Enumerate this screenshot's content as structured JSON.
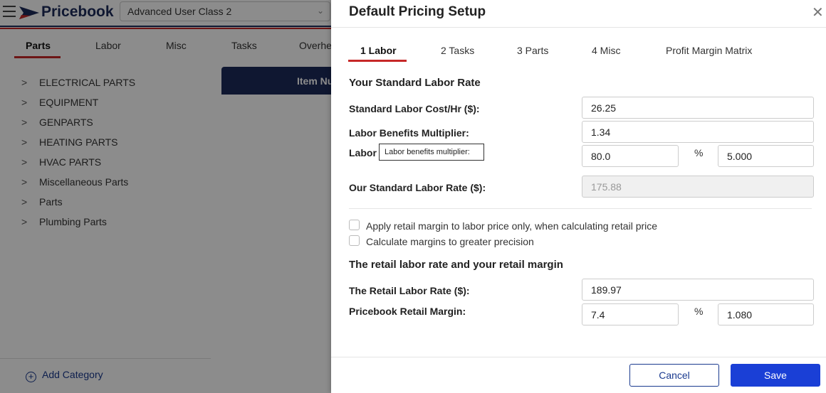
{
  "app": {
    "logo_text": "Pricebook",
    "class_select_value": "Advanced User Class 2",
    "tabs": [
      "Parts",
      "Labor",
      "Misc",
      "Tasks",
      "Overhe"
    ],
    "categories": [
      "ELECTRICAL PARTS",
      "EQUIPMENT",
      "GENPARTS",
      "HEATING PARTS",
      "HVAC PARTS",
      "Miscellaneous Parts",
      "Parts",
      "Plumbing Parts"
    ],
    "add_category_label": "Add Category",
    "item_header_label": "Item Nu",
    "colors": {
      "navy": "#1c2a5a",
      "red": "#c62828",
      "primary": "#1a3fd6"
    }
  },
  "dialog": {
    "title": "Default Pricing Setup",
    "close_icon": "close-icon",
    "tabs": [
      "1 Labor",
      "2 Tasks",
      "3 Parts",
      "4 Misc",
      "Profit Margin Matrix"
    ],
    "standard_section_title": "Your Standard Labor Rate",
    "labor_cost_label": "Standard Labor Cost/Hr ($):",
    "labor_cost_value": "26.25",
    "benefits_multiplier_label": "Labor Benefits Multiplier:",
    "benefits_multiplier_value": "1.34",
    "labor_row_label": "Labor",
    "labor_row_value_1": "80.0",
    "labor_row_value_2": "5.000",
    "pct_symbol": "%",
    "tooltip_text": "Labor benefits multiplier:",
    "our_rate_label": "Our Standard Labor Rate ($):",
    "our_rate_value": "175.88",
    "checkbox_1_label": "Apply retail margin to labor price only, when calculating retail price",
    "checkbox_2_label": "Calculate margins to greater precision",
    "retail_section_title": "The retail labor rate and your retail margin",
    "retail_rate_label": "The Retail Labor Rate ($):",
    "retail_rate_value": "189.97",
    "retail_margin_label": "Pricebook Retail Margin:",
    "retail_margin_value_1": "7.4",
    "retail_margin_value_2": "1.080",
    "cancel_label": "Cancel",
    "save_label": "Save"
  }
}
